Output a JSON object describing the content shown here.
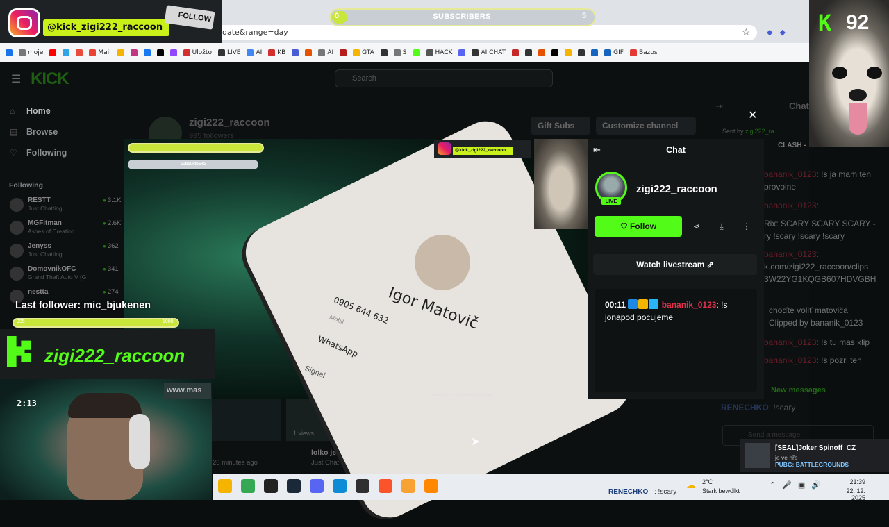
{
  "browser": {
    "address_text": "date&range=day",
    "bookmarks": [
      {
        "label": "",
        "color": "#1a73e8",
        "icon": "apps-icon"
      },
      {
        "label": "moje",
        "color": "#777777",
        "icon": "folder-icon"
      },
      {
        "label": "",
        "color": "#ff0000",
        "icon": "youtube-icon"
      },
      {
        "label": "",
        "color": "#2fa4e7",
        "icon": "bookmark-icon"
      },
      {
        "label": "",
        "color": "#e74c3c",
        "icon": "bookmark-icon"
      },
      {
        "label": "Mail",
        "color": "#ea4335",
        "icon": "gmail-icon"
      },
      {
        "label": "",
        "color": "#f4b400",
        "icon": "bookmark-icon"
      },
      {
        "label": "",
        "color": "#c13584",
        "icon": "instagram-icon"
      },
      {
        "label": "",
        "color": "#1877f2",
        "icon": "facebook-icon"
      },
      {
        "label": "",
        "color": "#000000",
        "icon": "tiktok-icon"
      },
      {
        "label": "",
        "color": "#9146ff",
        "icon": "twitch-icon"
      },
      {
        "label": "Uložto",
        "color": "#d32f2f",
        "icon": "ulozto-icon"
      },
      {
        "label": "LIVE",
        "color": "#333333",
        "icon": "live-icon"
      },
      {
        "label": "AI",
        "color": "#4285f4",
        "icon": "gemini-icon"
      },
      {
        "label": "KB",
        "color": "#d32f2f",
        "icon": "kb-icon"
      },
      {
        "label": "",
        "color": "#4a5bd6",
        "icon": "bookmark-icon"
      },
      {
        "label": "",
        "color": "#e65100",
        "icon": "bookmark-icon"
      },
      {
        "label": "AI",
        "color": "#777777",
        "icon": "folder-icon"
      },
      {
        "label": "",
        "color": "#b71c1c",
        "icon": "bookmark-icon"
      },
      {
        "label": "GTA",
        "color": "#f4b400",
        "icon": "gta-icon"
      },
      {
        "label": "",
        "color": "#333333",
        "icon": "bookmark-icon"
      },
      {
        "label": "S",
        "color": "#777777",
        "icon": "folder-icon"
      },
      {
        "label": "",
        "color": "#53fc18",
        "icon": "kick-icon"
      },
      {
        "label": "HACK",
        "color": "#555555",
        "icon": "hack-icon"
      },
      {
        "label": "",
        "color": "#5865f2",
        "icon": "discord-icon"
      },
      {
        "label": "AI CHAT",
        "color": "#333333",
        "icon": "ai-chat-icon"
      },
      {
        "label": "",
        "color": "#c62828",
        "icon": "bookmark-icon"
      },
      {
        "label": "",
        "color": "#333333",
        "icon": "bookmark-icon"
      },
      {
        "label": "",
        "color": "#e65100",
        "icon": "bookmark-icon"
      },
      {
        "label": "",
        "color": "#000000",
        "icon": "bookmark-icon"
      },
      {
        "label": "",
        "color": "#f4b400",
        "icon": "bookmark-icon"
      },
      {
        "label": "",
        "color": "#333333",
        "icon": "bookmark-icon"
      },
      {
        "label": "",
        "color": "#1565c0",
        "icon": "bookmark-icon"
      },
      {
        "label": "GIF",
        "color": "#1565c0",
        "icon": "gif-icon"
      },
      {
        "label": "Bazos",
        "color": "#e53935",
        "icon": "bazos-icon"
      }
    ]
  },
  "overlays": {
    "instagram_handle": "@kick_zigi222_raccoon",
    "follow_sign": "FOLLOW",
    "subscribers": {
      "label": "SUBSCRIBERS",
      "left": "0",
      "right": "5",
      "progress": 0.0
    },
    "kick_count": "92",
    "last_follower": "Last follower: mic_bjukenen",
    "kick_banner_name": "zigi222_raccoon",
    "cam_clock": "2:13",
    "cam_sign": "www.mas",
    "left_bar_left": "995",
    "left_bar_right": "1000",
    "clip_subscribers": "SUBSCRIBERS",
    "clip_ig_handle": "@kick_zigi222_raccoon",
    "clip_chat_line": "bananik_0123: !s jonapod pocujeme"
  },
  "kick_page": {
    "logo": "KICK",
    "search_placeholder": "Search",
    "nav": {
      "home": "Home",
      "browse": "Browse",
      "following": "Following"
    },
    "following_heading": "Following",
    "channels": [
      {
        "name": "RESTT",
        "category": "Just Chatting",
        "viewers": "3.1K"
      },
      {
        "name": "MGFitman",
        "category": "Ashes of Creation",
        "viewers": "2.6K"
      },
      {
        "name": "Jenyss",
        "category": "Just Chatting",
        "viewers": "362"
      },
      {
        "name": "DomovnikOFC",
        "category": "Grand Theft Auto V (G",
        "viewers": "341"
      },
      {
        "name": "nestta",
        "category": "",
        "viewers": "274"
      }
    ],
    "channel_name": "zigi222_raccoon",
    "channel_followers": "995 followers",
    "gift_subs": "Gift Subs",
    "customize_channel": "Customize channel",
    "side_chat_title": "Chat",
    "sent_by": "Sent by",
    "sent_by_user": "zigi222_ra",
    "clash": "CLASH -",
    "side_chat_lines": [
      {
        "user": "bananik_0123",
        "text": ": !s ja mam ten"
      },
      {
        "user": "",
        "text": "provolne"
      },
      {
        "user": "bananik_0123",
        "text": ":"
      },
      {
        "user": "",
        "text": "Rix: SCARY SCARY SCARY -"
      },
      {
        "user": "",
        "text": "ry !scary !scary !scary"
      },
      {
        "user": "bananik_0123",
        "text": ":"
      },
      {
        "user": "",
        "text": "k.com/zigi222_raccoon/clips"
      },
      {
        "user": "",
        "text": "3W22YG1KQGB607HDVGBH"
      },
      {
        "user": "",
        "text": "choďte voliť matoviča"
      },
      {
        "user": "",
        "text": "Clipped by bananik_0123"
      },
      {
        "user": "bananik_0123",
        "text": ": !s tu mas klip"
      },
      {
        "user": "bananik_0123",
        "text": ": !s pozri ten"
      }
    ],
    "new_messages": "New messages",
    "last_chat_user": "RENECHKO",
    "last_chat_text": ": !scary",
    "send_placeholder": "Send a message",
    "thumb_views": "1 views",
    "thumb_title": "lolko je rakovina",
    "thumb_sub": "Just Chat... · 42 minutes ago",
    "thumb_left_time": "26 minutes ago"
  },
  "clip_popup": {
    "title": "Chat",
    "channel": "zigi222_raccoon",
    "live_badge": "LIVE",
    "follow": "Follow",
    "watch": "Watch livestream",
    "message": {
      "time": "00:11",
      "user": "bananik_0123",
      "text": ": !s jonapod pocujeme"
    },
    "phone": {
      "name": "Igor Matovič",
      "number": "0905 644 632",
      "type": "Mobil",
      "app1": "WhatsApp",
      "app2": "Signal"
    }
  },
  "taskbar": {
    "ticker_user": "RENECHKO",
    "ticker_text": ": !scary",
    "temp": "2°C",
    "weather": "Stark bewölkt",
    "time": "21:39",
    "date": "22. 12. 2025",
    "apps": [
      {
        "name": "file-explorer-icon",
        "color": "#f4b400"
      },
      {
        "name": "chrome-icon",
        "color": "#34a853"
      },
      {
        "name": "epic-games-icon",
        "color": "#222222"
      },
      {
        "name": "steam-icon",
        "color": "#1b2838"
      },
      {
        "name": "discord-icon",
        "color": "#5865f2"
      },
      {
        "name": "edge-icon",
        "color": "#0c8bd6"
      },
      {
        "name": "obs-icon",
        "color": "#302e31"
      },
      {
        "name": "brave-icon",
        "color": "#fb542b"
      },
      {
        "name": "app-icon",
        "color": "#f7a233"
      },
      {
        "name": "vlc-icon",
        "color": "#ff8800"
      }
    ]
  },
  "notification": {
    "name": "[SEAL]Joker Spinoff_CZ",
    "status": "je ve hře",
    "game": "PUBG: BATTLEGROUNDS"
  }
}
